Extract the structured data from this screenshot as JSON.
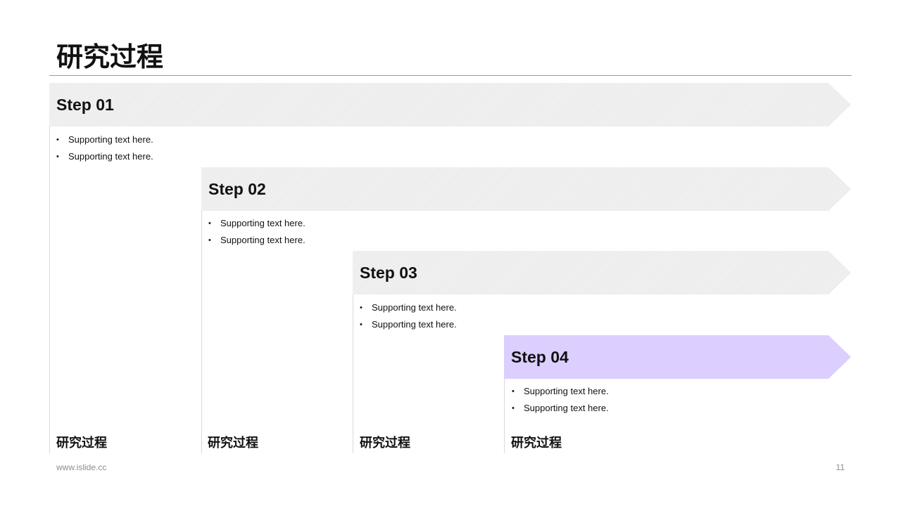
{
  "page": {
    "title": "研究过程"
  },
  "steps": [
    {
      "label": "Step 01",
      "bullets": [
        "Supporting  text here.",
        "Supporting  text here."
      ],
      "column_label": "研究过程"
    },
    {
      "label": "Step 02",
      "bullets": [
        "Supporting  text here.",
        "Supporting  text here."
      ],
      "column_label": "研究过程"
    },
    {
      "label": "Step 03",
      "bullets": [
        "Supporting  text here.",
        "Supporting  text here."
      ],
      "column_label": "研究过程"
    },
    {
      "label": "Step 04",
      "bullets": [
        "Supporting  text here.",
        "Supporting  text here."
      ],
      "column_label": "研究过程"
    }
  ],
  "colors": {
    "active_step": "#dccfff",
    "inactive_step": "#f0f0f0"
  },
  "footer": {
    "website": "www.islide.cc",
    "page_number": "11"
  }
}
